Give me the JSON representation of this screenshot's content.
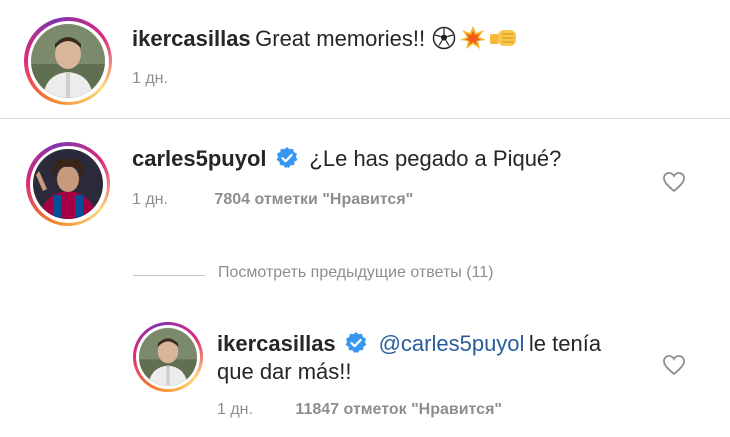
{
  "caption": {
    "username": "ikercasillas",
    "text": "Great memories!!",
    "emojis": [
      "soccer-ball-icon",
      "collision-icon",
      "fist-bump-icon"
    ],
    "time": "1 дн."
  },
  "comments": [
    {
      "username": "carles5puyol",
      "verified": true,
      "text": "¿Le has pegado a Piqué?",
      "time": "1 дн.",
      "likes": "7804 отметки \"Нравится\""
    }
  ],
  "view_replies": "Посмотреть предыдущие ответы (11)",
  "reply": {
    "username": "ikercasillas",
    "verified": true,
    "mention": "@carles5puyol",
    "text_line1": "le tenía",
    "text_line2": "que dar más!!",
    "time": "1 дн.",
    "likes": "11847 отметок \"Нравится\""
  },
  "colors": {
    "verified_badge": "#3897f0",
    "mention": "#2b5d9c",
    "meta": "#8e8e8e"
  }
}
